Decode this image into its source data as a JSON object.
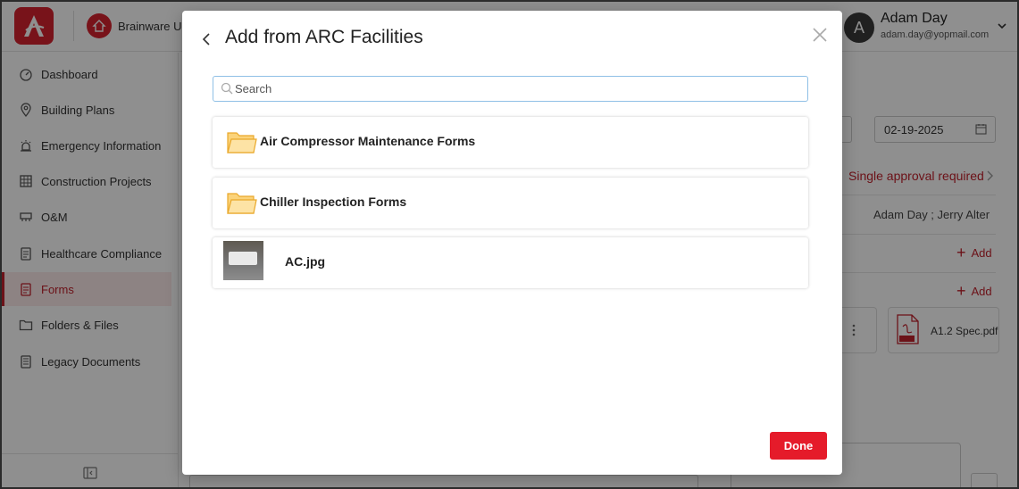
{
  "header": {
    "org_name": "Brainware Ur",
    "user": {
      "initial": "A",
      "name": "Adam Day",
      "email": "adam.day@yopmail.com"
    }
  },
  "sidebar": {
    "items": [
      {
        "label": "Dashboard",
        "icon": "gauge-icon"
      },
      {
        "label": "Building Plans",
        "icon": "location-pin-icon"
      },
      {
        "label": "Emergency Information",
        "icon": "alarm-icon"
      },
      {
        "label": "Construction Projects",
        "icon": "construction-icon"
      },
      {
        "label": "O&M",
        "icon": "om-icon"
      },
      {
        "label": "Healthcare Compliance",
        "icon": "clipboard-icon"
      },
      {
        "label": "Forms",
        "icon": "form-icon",
        "active": true
      },
      {
        "label": "Folders & Files",
        "icon": "folder-icon"
      },
      {
        "label": "Legacy Documents",
        "icon": "document-stack-icon"
      }
    ]
  },
  "background": {
    "date_value": "02-19-2025",
    "approval_text": "Single approval required",
    "users_text": "Adam Day ;   Jerry Alter",
    "add_label_1": "Add",
    "add_label_2": "Add",
    "pdf_name": "A1.2 Spec.pdf"
  },
  "modal": {
    "title": "Add from ARC Facilities",
    "search_placeholder": "Search",
    "items": [
      {
        "type": "folder",
        "label": "Air Compressor Maintenance Forms"
      },
      {
        "type": "folder",
        "label": "Chiller Inspection Forms"
      },
      {
        "type": "image",
        "label": "AC.jpg"
      }
    ],
    "done_label": "Done"
  },
  "colors": {
    "brand_red": "#d7232f",
    "done_red": "#e51b2a",
    "folder_yellow": "#f7c14a",
    "search_focus_border": "#8fc0e6"
  }
}
